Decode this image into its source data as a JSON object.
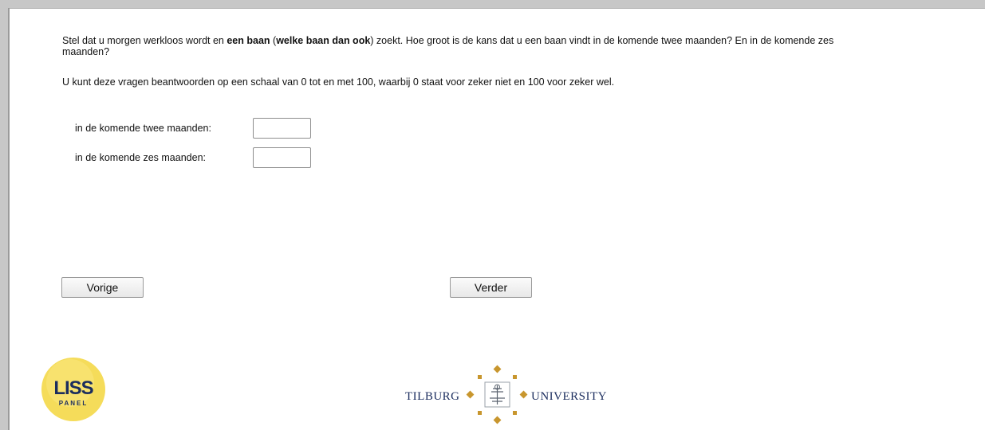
{
  "question": {
    "part1": "Stel dat u morgen werkloos wordt en ",
    "bold1": "een baan",
    "part2": " (",
    "bold2": "welke baan dan ook",
    "part3": ") zoekt. Hoe groot is de kans dat u een baan vindt in de komende twee maanden? En in de komende zes maanden?"
  },
  "scale_note": "U kunt deze vragen beantwoorden op een schaal van 0 tot en met 100, waarbij 0 staat voor zeker niet en 100 voor zeker wel.",
  "fields": [
    {
      "label": "in de komende twee maanden:",
      "value": ""
    },
    {
      "label": "in de komende zes maanden:",
      "value": ""
    }
  ],
  "buttons": {
    "prev": "Vorige",
    "next": "Verder"
  },
  "logos": {
    "liss": {
      "top": "LISS",
      "bottom": "PANEL",
      "color": "#f5dc5a"
    },
    "tilburg": {
      "left": "TILBURG",
      "right": "UNIVERSITY",
      "accent": "#c8962e",
      "text_color": "#1b2d5e"
    }
  }
}
